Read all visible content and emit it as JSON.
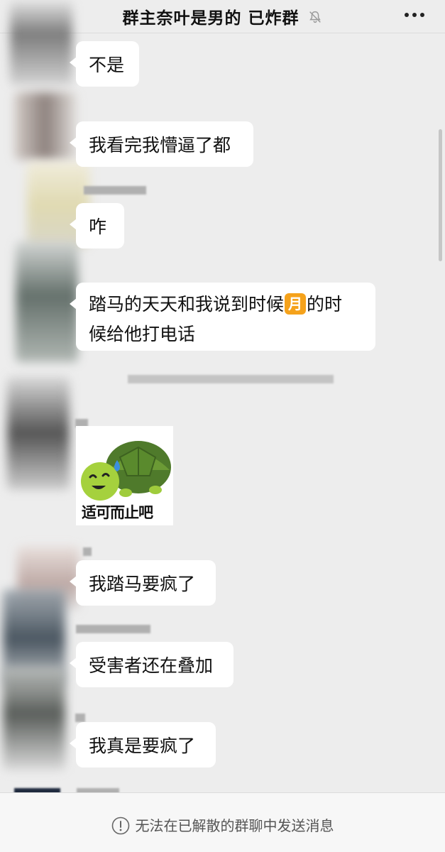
{
  "header": {
    "title": "群主奈叶是男的 已炸群",
    "mute_icon": "bell-muted-icon",
    "more_icon": "more-horizontal-icon"
  },
  "messages": [
    {
      "text": "不是"
    },
    {
      "text": "我看完我懵逼了都"
    },
    {
      "text": "咋"
    },
    {
      "text_line1_a": "踏马的天天和我说到时候",
      "emoji": "月",
      "text_line1_b": "的时",
      "text_line2": "候给他打电话"
    },
    {
      "sticker_caption": "适可而止吧"
    },
    {
      "text": "我踏马要疯了"
    },
    {
      "text": "受害者还在叠加"
    },
    {
      "text": "我真是要疯了"
    }
  ],
  "footer": {
    "notice": "无法在已解散的群聊中发送消息",
    "icon": "info-circle-icon"
  },
  "colors": {
    "background": "#ededed",
    "bubble": "#ffffff",
    "emoji_badge": "#f5a21b"
  }
}
